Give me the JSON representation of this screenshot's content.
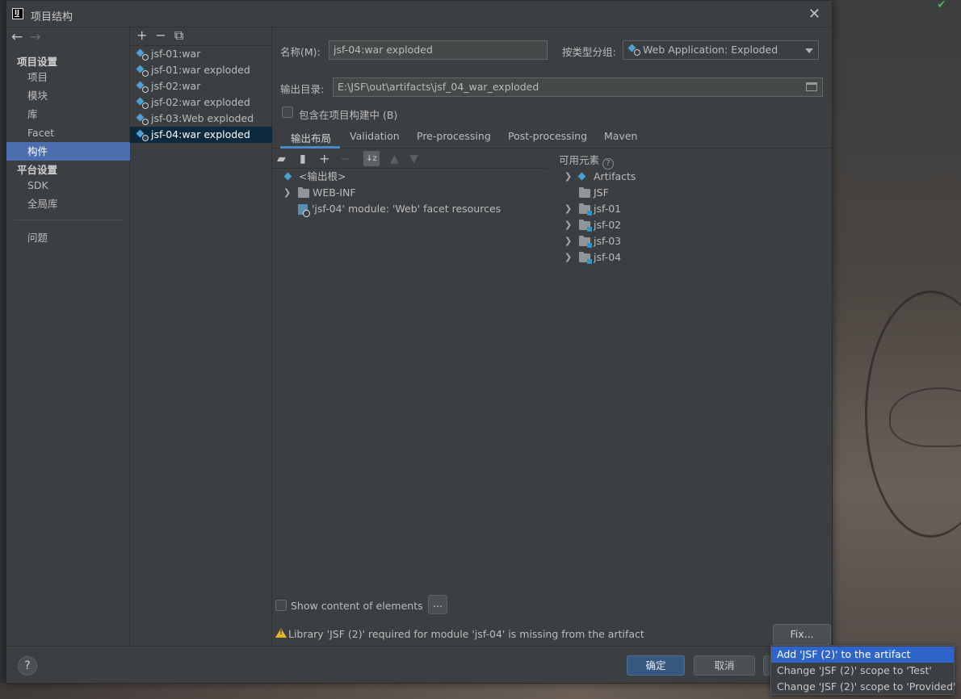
{
  "window": {
    "title": "项目结构",
    "app_icon": "IJ"
  },
  "nav": {
    "section_project": "项目设置",
    "items_project": [
      "项目",
      "模块",
      "库",
      "Facet",
      "构件"
    ],
    "selected": "构件",
    "section_platform": "平台设置",
    "items_platform": [
      "SDK",
      "全局库"
    ],
    "problems": "问题"
  },
  "artifacts": {
    "toolbar": [
      "+",
      "−",
      "⧉"
    ],
    "items": [
      "jsf-01:war",
      "jsf-01:war exploded",
      "jsf-02:war",
      "jsf-02:war exploded",
      "jsf-03:Web exploded",
      "jsf-04:war exploded"
    ],
    "selected_index": 5
  },
  "form": {
    "name_label": "名称(M):",
    "name_value": "jsf-04:war exploded",
    "type_label": "按类型分组:",
    "type_value": "Web Application: Exploded",
    "output_label": "输出目录:",
    "output_value": "E:\\JSF\\out\\artifacts\\jsf_04_war_exploded",
    "include_label": "包含在项目构建中 (B)"
  },
  "tabs": [
    "输出布局",
    "Validation",
    "Pre-processing",
    "Post-processing",
    "Maven"
  ],
  "active_tab": "输出布局",
  "layout_tree": {
    "root": "<输出根>",
    "web_inf": "WEB-INF",
    "module_resource": "'jsf-04' module: 'Web' facet resources"
  },
  "available": {
    "label": "可用元素",
    "items": [
      "Artifacts",
      "JSF",
      "jsf-01",
      "jsf-02",
      "jsf-03",
      "jsf-04"
    ]
  },
  "bottom": {
    "show_content_label": "Show content of elements",
    "dots": "...",
    "warning": "Library 'JSF (2)' required for module 'jsf-04' is missing from the artifact",
    "fix_label": "Fix..."
  },
  "footer": {
    "help": "?",
    "ok": "确定",
    "cancel": "取消"
  },
  "popup": {
    "items": [
      "Add 'JSF (2)' to the artifact",
      "Change 'JSF (2)' scope to 'Test'",
      "Change 'JSF (2)' scope to 'Provided'"
    ]
  },
  "colors": {
    "selection_blue": "#4b6eaf",
    "ok_button": "#365880",
    "popup_highlight": "#2f65ca",
    "warning": "#e6b422"
  }
}
